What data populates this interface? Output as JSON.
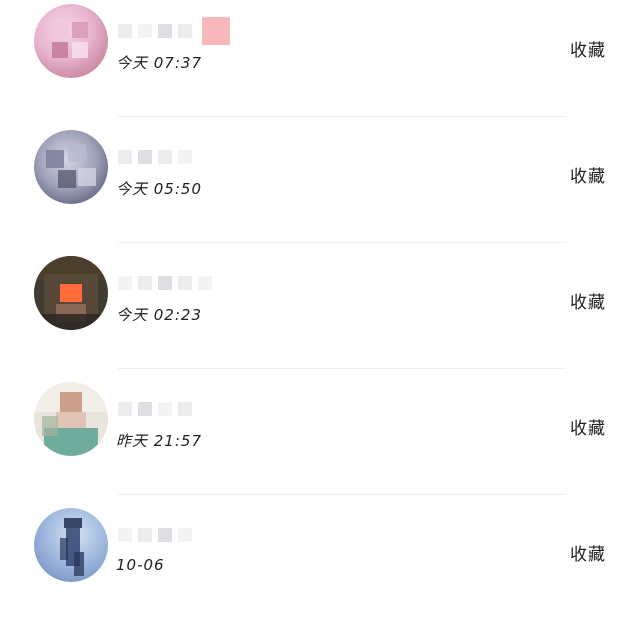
{
  "items": [
    {
      "time": "今天 07:37",
      "action": "收藏",
      "has_badge": true,
      "avatar_colors": [
        "#e7b4cf",
        "#c9869f",
        "#f5d7e6"
      ]
    },
    {
      "time": "今天 05:50",
      "action": "收藏",
      "has_badge": false,
      "avatar_colors": [
        "#9fa2b9",
        "#5b5e76",
        "#d7d8e4"
      ]
    },
    {
      "time": "今天 02:23",
      "action": "收藏",
      "has_badge": false,
      "avatar_colors": [
        "#3f3b2e",
        "#ff6b3b",
        "#8b6a58"
      ]
    },
    {
      "time": "昨天 21:57",
      "action": "收藏",
      "has_badge": false,
      "avatar_colors": [
        "#e9e4dc",
        "#a2b39c",
        "#69a999"
      ]
    },
    {
      "time": "10-06",
      "action": "收藏",
      "has_badge": false,
      "avatar_colors": [
        "#9db7dd",
        "#3a4b77",
        "#d7e2f3"
      ]
    }
  ]
}
